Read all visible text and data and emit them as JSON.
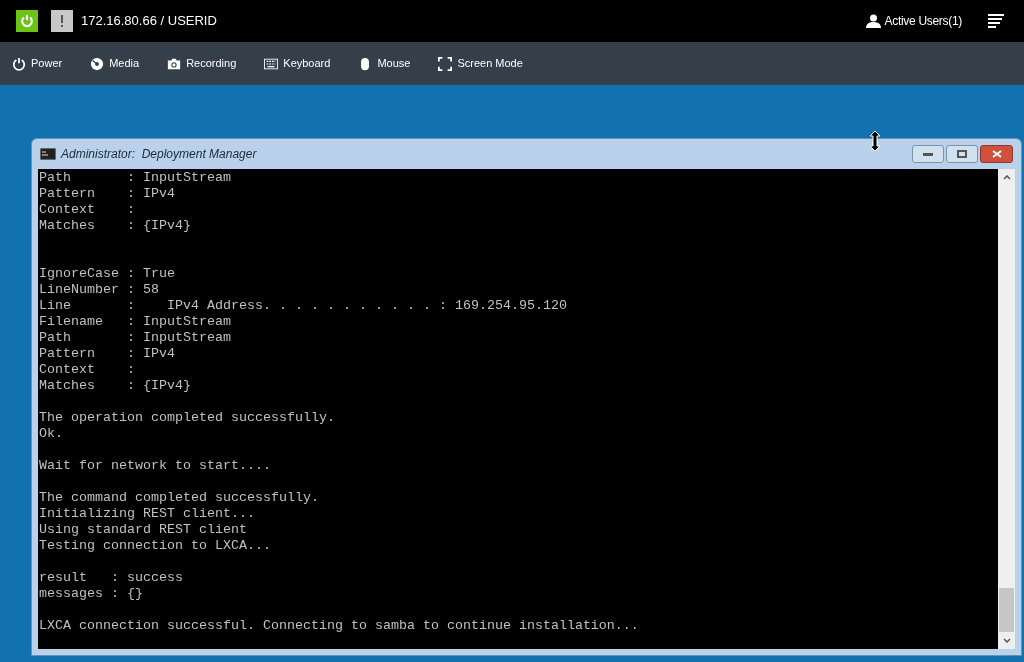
{
  "header": {
    "address": "172.16.80.66 / USERID",
    "active_users": "Active Users(1)"
  },
  "toolbar": [
    {
      "kind": "power",
      "label": "Power"
    },
    {
      "kind": "media",
      "label": "Media"
    },
    {
      "kind": "recording",
      "label": "Recording"
    },
    {
      "kind": "keyboard",
      "label": "Keyboard"
    },
    {
      "kind": "mouse",
      "label": "Mouse"
    },
    {
      "kind": "screen",
      "label": "Screen Mode"
    }
  ],
  "window": {
    "title": "Administrator:  Deployment Manager",
    "lines": [
      {
        "kind": "text",
        "text": "Path       : InputStream"
      },
      {
        "kind": "text",
        "text": "Pattern    : IPv4"
      },
      {
        "kind": "text",
        "text": "Context    :"
      },
      {
        "kind": "text",
        "text": "Matches    : {IPv4}"
      },
      {
        "kind": "blank"
      },
      {
        "kind": "blank"
      },
      {
        "kind": "text",
        "text": "IgnoreCase : True"
      },
      {
        "kind": "text",
        "text": "LineNumber : 58"
      },
      {
        "kind": "text",
        "text": "Line       :    IPv4 Address. . . . . . . . . . . : 169.254.95.120"
      },
      {
        "kind": "text",
        "text": "Filename   : InputStream"
      },
      {
        "kind": "text",
        "text": "Path       : InputStream"
      },
      {
        "kind": "text",
        "text": "Pattern    : IPv4"
      },
      {
        "kind": "text",
        "text": "Context    :"
      },
      {
        "kind": "text",
        "text": "Matches    : {IPv4}"
      },
      {
        "kind": "blank"
      },
      {
        "kind": "text",
        "text": "The operation completed successfully."
      },
      {
        "kind": "text",
        "text": "Ok."
      },
      {
        "kind": "blank"
      },
      {
        "kind": "text",
        "text": "Wait for network to start...."
      },
      {
        "kind": "blank"
      },
      {
        "kind": "text",
        "text": "The command completed successfully."
      },
      {
        "kind": "text",
        "text": "Initializing REST client..."
      },
      {
        "kind": "text",
        "text": "Using standard REST client"
      },
      {
        "kind": "text",
        "text": "Testing connection to LXCA..."
      },
      {
        "kind": "blank"
      },
      {
        "kind": "text",
        "text": "result   : success"
      },
      {
        "kind": "text",
        "text": "messages : {}"
      },
      {
        "kind": "blank"
      },
      {
        "kind": "text",
        "text": "LXCA connection successful. Connecting to samba to continue installation..."
      }
    ]
  }
}
